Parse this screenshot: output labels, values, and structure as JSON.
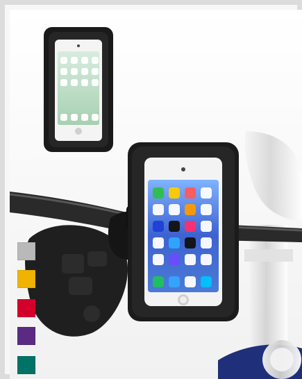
{
  "image": {
    "description_for_alt": ""
  },
  "color_swatches": [
    {
      "name": "silver",
      "color": "#b9b9b9"
    },
    {
      "name": "yellow",
      "color": "#f0b400"
    },
    {
      "name": "red",
      "color": "#d3002c"
    },
    {
      "name": "purple",
      "color": "#5b2b83"
    },
    {
      "name": "teal",
      "color": "#007266"
    }
  ],
  "colors": {
    "frame_border": "#dcdcdc",
    "case_black": "#1b1b1b",
    "chrome": "#cfcfcf",
    "tank_blue": "#1f2f7a"
  }
}
